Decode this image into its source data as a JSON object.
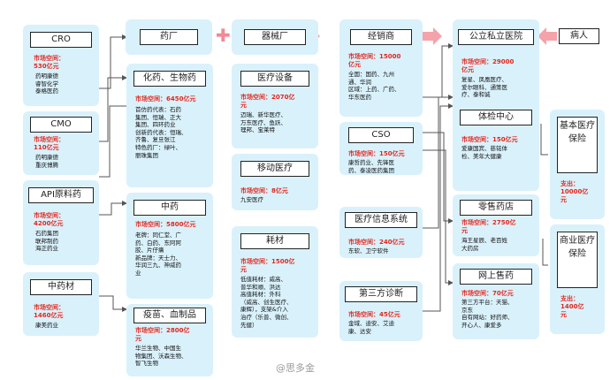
{
  "headers": {
    "pharma": "药厂",
    "device": "器械厂",
    "distributor": "经销商",
    "hospital": "公立私立医院",
    "patient": "病人"
  },
  "left": {
    "cro": {
      "title": "CRO",
      "market": "市场空间：\n530亿元",
      "desc": "药明康德\n睿智化学\n泰格医药"
    },
    "cmo": {
      "title": "CMO",
      "market": "市场空间：\n110亿元",
      "desc": "药明康德\n重庆博腾"
    },
    "api": {
      "title": "API原料药",
      "market": "市场空间：\n4200亿元",
      "desc": "石药集团\n联邦制药\n海正药业"
    },
    "tcm_raw": {
      "title": "中药材",
      "market": "市场空间：\n1460亿元",
      "desc": "康美药业"
    }
  },
  "pharma": {
    "chem": {
      "title": "化药、生物药",
      "market": "市场空间：6450亿元",
      "desc": "首仿药代表：石药\n集团、恒瑞、正大\n集团、四环药业\n创新药代表：恒瑞、\n齐鲁、复旦张江\n特色药厂：绿叶、\n丽珠集团"
    },
    "tcm": {
      "title": "中药",
      "market": "市场空间：5800亿元",
      "desc": "老牌：同仁堂、广\n药、白药、东阿阿\n胶、片仔癀\n新品牌：天士力、\n华润三九、神威药\n业"
    },
    "vaccine": {
      "title": "疫苗、血制品",
      "market": "市场空间：2800亿\n元",
      "desc": "华兰生物、中国生\n物集团、沃森生物、\n智飞生物"
    }
  },
  "device": {
    "equipment": {
      "title": "医疗设备",
      "market": "市场空间：2070亿\n元",
      "desc": "迈瑞、新华医疗、\n万东医疗、鱼跃、\n理邦、宝莱特"
    },
    "mobile": {
      "title": "移动医疗",
      "market": "市场空间：8亿元",
      "desc": "九安医疗"
    },
    "consumables": {
      "title": "耗材",
      "market": "市场空间：1500亿\n元",
      "desc": "低值耗材：威高、\n普华和顺、洪达\n高值耗材：外科\n（威高、创生医疗、\n康辉），支架&介入\n治疗（乐普、微创、\n先健）"
    }
  },
  "middle": {
    "distributor": {
      "market": "市场空间：15000\n亿元",
      "desc": "全国：国药、九州\n通、华润\n区域：上药、广药、\n华东医药"
    },
    "cso": {
      "title": "CSO",
      "market": "市场空间：150亿元",
      "desc": "康哲药业、先锋医\n药、泰凌医药集团"
    },
    "his": {
      "title": "医疗信息系统",
      "market": "市场空间：240亿元",
      "desc": "东软、卫宁软件"
    },
    "lab": {
      "title": "第三方诊断",
      "market": "市场空间：45亿元",
      "desc": "金域、迪安、艾迪\n康、达安"
    }
  },
  "right": {
    "hospital": {
      "market": "市场空间：29000\n亿元",
      "desc": "复星、凤凰医疗、\n爱尔眼科、通策医\n疗、泰和诚"
    },
    "checkup": {
      "title": "体检中心",
      "market": "市场空间：150亿元",
      "desc": "爱康国宾、慈铭体\n检、美年大健康"
    },
    "pharmacy": {
      "title": "零售药店",
      "market": "市场空间：2750亿\n元",
      "desc": "海王星辰、老百姓\n大药房"
    },
    "online": {
      "title": "网上售药",
      "market": "市场空间：70亿元",
      "desc": "第三方平台：天猫、\n京东\n自有网站：好药师、\n开心人、康爱多"
    },
    "basic_ins": {
      "title": "基本医疗保险",
      "market": "支出：\n10000亿\n元"
    },
    "comm_ins": {
      "title": "商业医疗保险",
      "market": "支出：\n1400亿\n元"
    }
  },
  "watermark": "@思多金",
  "colors": {
    "box": "#d9f1fb",
    "market": "#e4261c",
    "arrow": "#f4a3ab",
    "line": "#555555"
  }
}
